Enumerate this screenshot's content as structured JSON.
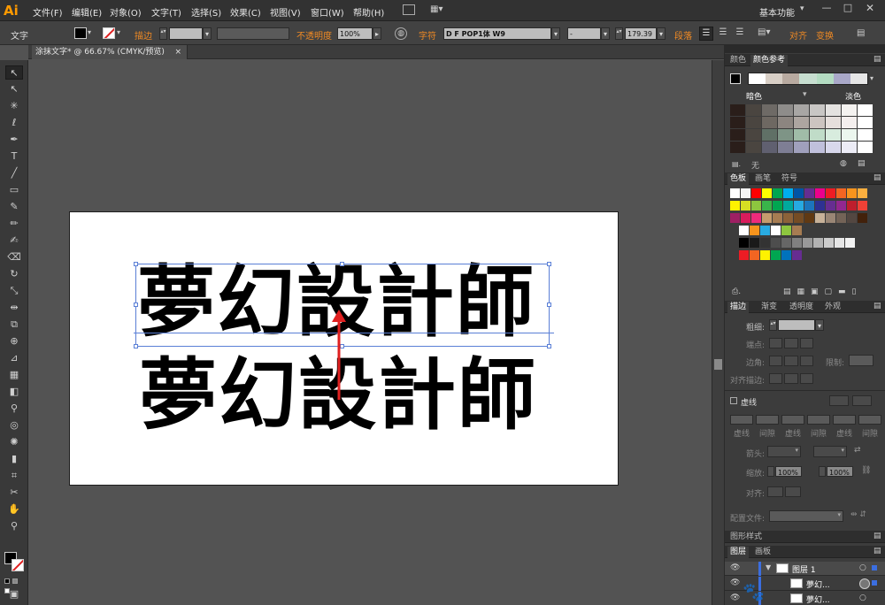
{
  "app": {
    "logo": "Ai",
    "workspace": "基本功能"
  },
  "menu": [
    "文件(F)",
    "编辑(E)",
    "对象(O)",
    "文字(T)",
    "选择(S)",
    "效果(C)",
    "视图(V)",
    "窗口(W)",
    "帮助(H)"
  ],
  "control_bar": {
    "tool_name": "文字",
    "stroke_label": "描边",
    "opacity_label": "不透明度",
    "opacity_value": "100%",
    "char_label": "字符",
    "font_name": "D F POP1体 W9",
    "font_style": "-",
    "font_size": "179.39",
    "para_label": "段落",
    "align_label": "对齐",
    "transform_label": "变换"
  },
  "document": {
    "tab_title": "涂抹文字* @ 66.67% (CMYK/预览)",
    "close_glyph": "×"
  },
  "artboard": {
    "line1": "夢幻設計師",
    "line2": "夢幻設計師",
    "arrow_color": "#e02020"
  },
  "panels": {
    "color_tabs": [
      "颜色",
      "颜色参考"
    ],
    "guide_labels": {
      "left": "暗色",
      "right": "淡色"
    },
    "none_label": "无",
    "swatch_tabs": [
      "色板",
      "画笔",
      "符号"
    ],
    "stroke_tabs": [
      "描边",
      "渐变",
      "透明度",
      "外观"
    ],
    "stroke": {
      "weight_label": "粗细:",
      "cap_label": "端点:",
      "corner_label": "边角:",
      "limit_label": "限制:",
      "align_label": "对齐描边:",
      "dashed_label": "虚线",
      "dash_labels": [
        "虚线",
        "间隙",
        "虚线",
        "间隙",
        "虚线",
        "间隙"
      ],
      "arrow_label": "箭头:",
      "scale_label": "缩放:",
      "scale_a": "100%",
      "scale_b": "100%",
      "align2_label": "对齐:",
      "profile_label": "配置文件:"
    },
    "graphic_style_tab": "图形样式",
    "layer_tabs": [
      "图层",
      "画板"
    ],
    "layers": [
      "图层 1",
      "夢幻...",
      "夢幻..."
    ]
  }
}
